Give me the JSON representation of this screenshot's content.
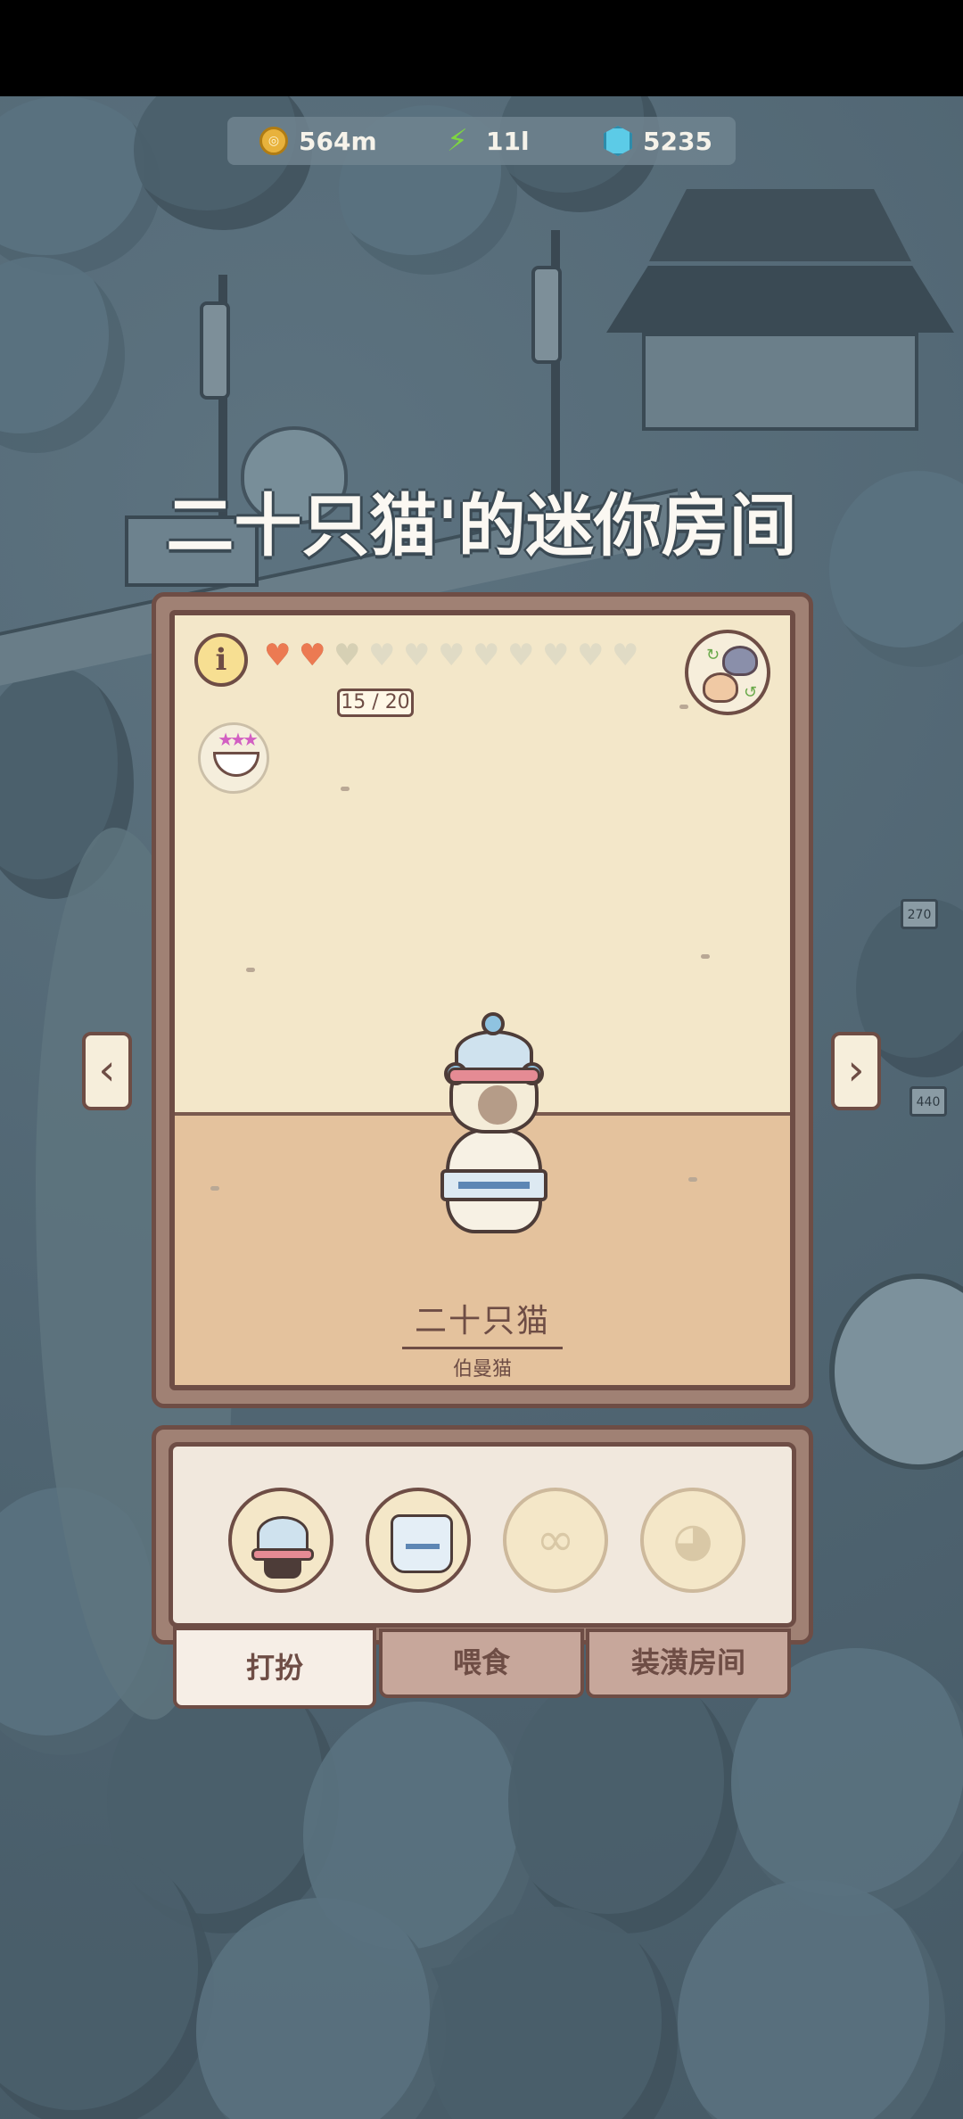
{
  "currencies": {
    "coins": "564m",
    "energy": "11l",
    "gems": "5235"
  },
  "room_title": "二十只猫'的迷你房间",
  "room": {
    "info_label": "i",
    "hearts": {
      "filled": 2,
      "partial": 1,
      "total": 11
    },
    "heart_count": "15 / 20",
    "cat_name": "二十只猫",
    "cat_breed": "伯曼猫"
  },
  "signs": [
    "270",
    "440"
  ],
  "nav": {
    "prev": "‹",
    "next": "›"
  },
  "slots": [
    {
      "name": "hat-slot",
      "state": "equipped"
    },
    {
      "name": "outfit-slot",
      "state": "equipped"
    },
    {
      "name": "glasses-slot",
      "state": "empty",
      "icon": "glasses-icon"
    },
    {
      "name": "pet-slot",
      "state": "empty",
      "icon": "cat-face-icon"
    }
  ],
  "tabs": [
    {
      "label": "打扮",
      "active": true
    },
    {
      "label": "喂食",
      "active": false
    },
    {
      "label": "装潢房间",
      "active": false
    }
  ],
  "colors": {
    "frame": "#a08174",
    "outline": "#6e4d45",
    "wall": "#f3e7c9",
    "floor": "#e4c29d",
    "heart": "#ec7a52"
  }
}
